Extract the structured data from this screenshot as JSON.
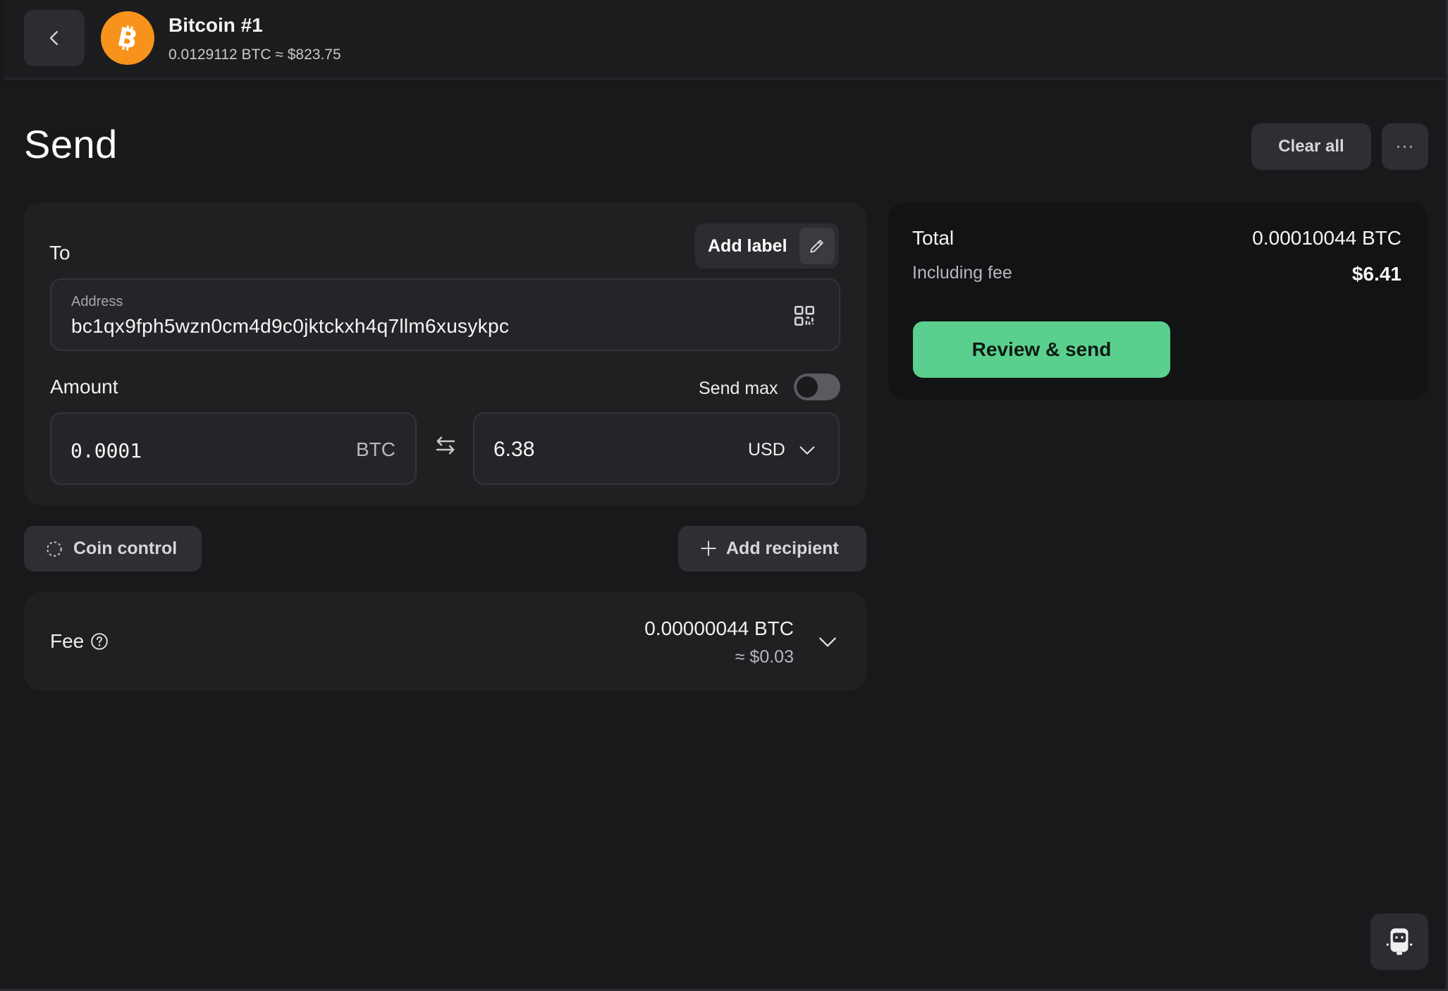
{
  "header": {
    "account_name": "Bitcoin #1",
    "balance": "0.0129112 BTC ≈ $823.75",
    "back_icon": "chevron-left-icon",
    "coin_icon": "bitcoin-icon"
  },
  "page": {
    "title": "Send",
    "clear_all_label": "Clear all",
    "more_label": "···"
  },
  "recipient": {
    "to_label": "To",
    "add_label_text": "Add label",
    "address_caption": "Address",
    "address_value": "bc1qx9fph5wzn0cm4d9c0jktckxh4q7llm6xusykpc",
    "amount_label": "Amount",
    "send_max_label": "Send max",
    "send_max_enabled": false,
    "amount_btc": "0.0001",
    "amount_btc_unit": "BTC",
    "amount_fiat": "6.38",
    "amount_fiat_unit": "USD"
  },
  "actions": {
    "coin_control_label": "Coin control",
    "add_recipient_label": "Add recipient"
  },
  "fee": {
    "label": "Fee",
    "btc": "0.00000044 BTC",
    "usd": "≈ $0.03"
  },
  "summary": {
    "total_label": "Total",
    "total_btc": "0.00010044 BTC",
    "including_fee_label": "Including fee",
    "total_usd": "$6.41",
    "review_label": "Review & send"
  },
  "colors": {
    "background": "#18191b",
    "bitcoin": "#f7931a",
    "primary_green": "#5bd08e"
  }
}
